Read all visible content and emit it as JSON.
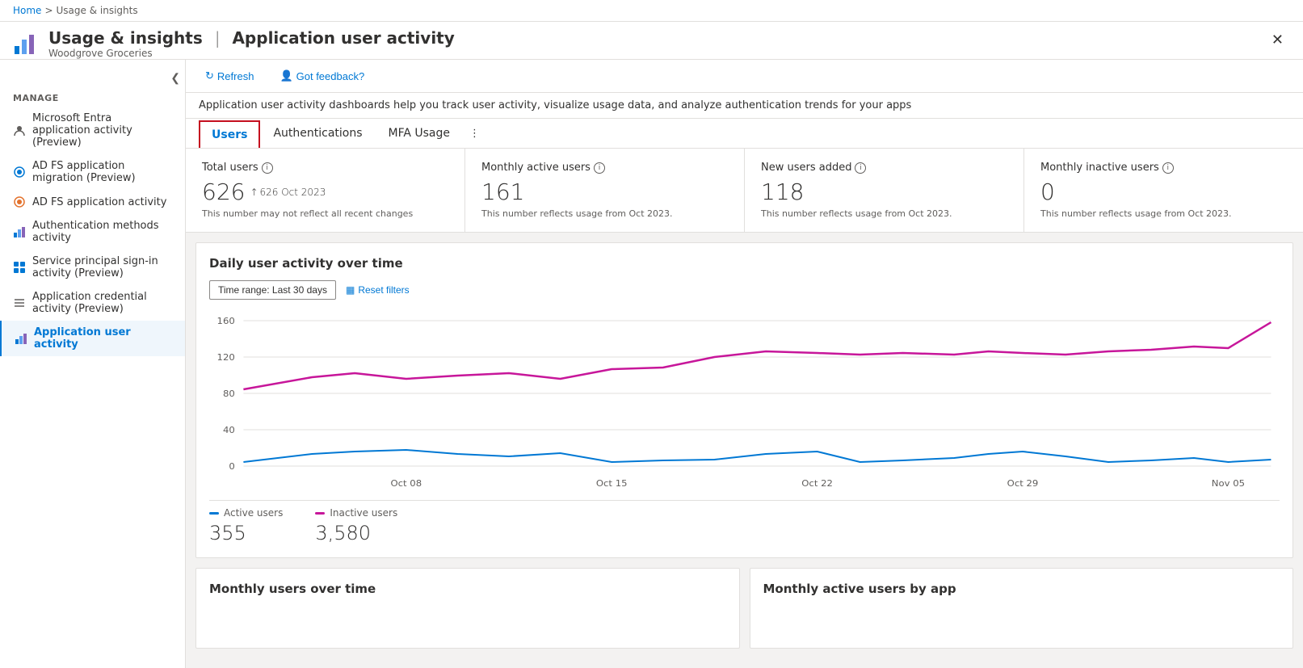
{
  "breadcrumb": {
    "home": "Home",
    "current": "Usage & insights"
  },
  "header": {
    "title": "Usage & insights",
    "separator": "|",
    "page": "Application user activity",
    "subtitle": "Woodgrove Groceries"
  },
  "toolbar": {
    "refresh_label": "Refresh",
    "feedback_label": "Got feedback?"
  },
  "info_bar": {
    "text": "Application user activity dashboards help you track user activity, visualize usage data, and analyze authentication trends for your apps"
  },
  "tabs": [
    {
      "label": "Users",
      "active": true
    },
    {
      "label": "Authentications",
      "active": false
    },
    {
      "label": "MFA Usage",
      "active": false
    }
  ],
  "stats": [
    {
      "label": "Total users",
      "value": "626",
      "trend": "626 Oct 2023",
      "trend_up": true,
      "note": "This number may not reflect all recent changes"
    },
    {
      "label": "Monthly active users",
      "value": "161",
      "note": "This number reflects usage from Oct 2023."
    },
    {
      "label": "New users added",
      "value": "118",
      "note": "This number reflects usage from Oct 2023."
    },
    {
      "label": "Monthly inactive users",
      "value": "0",
      "note": "This number reflects usage from Oct 2023."
    }
  ],
  "chart": {
    "title": "Daily user activity over time",
    "time_range_label": "Time range: Last 30 days",
    "reset_filters_label": "Reset filters",
    "x_labels": [
      "Oct 08",
      "Oct 15",
      "Oct 22",
      "Oct 29",
      "Nov 05"
    ],
    "y_labels": [
      "0",
      "40",
      "80",
      "120",
      "160"
    ],
    "legend": [
      {
        "label": "Active users",
        "value": "355",
        "color": "#0078d4"
      },
      {
        "label": "Inactive users",
        "value": "3,580",
        "color": "#c7169a"
      }
    ]
  },
  "bottom_cards": [
    {
      "title": "Monthly users over time"
    },
    {
      "title": "Monthly active users by app"
    }
  ],
  "sidebar": {
    "section_title": "Manage",
    "items": [
      {
        "label": "Microsoft Entra application activity (Preview)",
        "icon": "person",
        "active": false
      },
      {
        "label": "AD FS application migration (Preview)",
        "icon": "adfs-migrate",
        "active": false
      },
      {
        "label": "AD FS application activity",
        "icon": "adfs-activity",
        "active": false
      },
      {
        "label": "Authentication methods activity",
        "icon": "chart-bar",
        "active": false
      },
      {
        "label": "Service principal sign-in activity (Preview)",
        "icon": "grid",
        "active": false
      },
      {
        "label": "Application credential activity (Preview)",
        "icon": "list",
        "active": false
      },
      {
        "label": "Application user activity",
        "icon": "chart-bar2",
        "active": true
      }
    ]
  }
}
